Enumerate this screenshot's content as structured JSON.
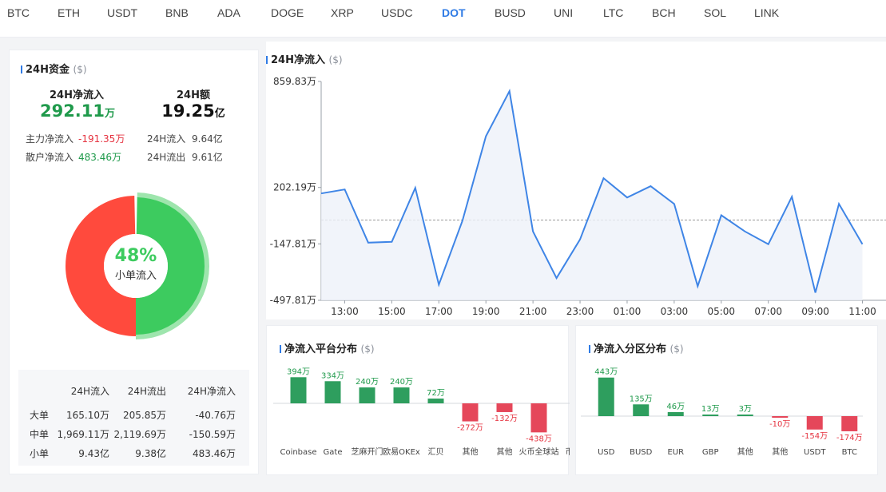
{
  "tabs": [
    "BTC",
    "ETH",
    "USDT",
    "BNB",
    "ADA",
    "DOGE",
    "XRP",
    "USDC",
    "DOT",
    "BUSD",
    "UNI",
    "LTC",
    "BCH",
    "SOL",
    "LINK"
  ],
  "active_tab": "DOT",
  "funds": {
    "title": "24H资金",
    "unit": "($)",
    "net_inflow_label": "24H净流入",
    "net_inflow_value": "292.11",
    "net_inflow_unit": "万",
    "volume_label": "24H额",
    "volume_value": "19.25",
    "volume_unit": "亿",
    "main_label": "主力净流入",
    "main_value": "-191.35万",
    "retail_label": "散户净流入",
    "retail_value": "483.46万",
    "in_label": "24H流入",
    "in_value": "9.64亿",
    "out_label": "24H流出",
    "out_value": "9.61亿",
    "donut_pct": "48%",
    "donut_label": "小单流入",
    "donut_fraction": 0.48,
    "colors": {
      "red": "#ff4a3d",
      "green": "#3dcb5f"
    }
  },
  "order_table": {
    "headers": [
      "24H流入",
      "24H流出",
      "24H净流入"
    ],
    "rows": [
      {
        "name": "大单",
        "in": "165.10万",
        "out": "205.85万",
        "net": "-40.76万",
        "sign": "neg"
      },
      {
        "name": "中单",
        "in": "1,969.11万",
        "out": "2,119.69万",
        "net": "-150.59万",
        "sign": "neg"
      },
      {
        "name": "小单",
        "in": "9.43亿",
        "out": "9.38亿",
        "net": "483.46万",
        "sign": "pos"
      }
    ]
  },
  "net_flow_chart": {
    "title": "24H净流入",
    "unit": "($)",
    "y_tick_labels": [
      "859.83万",
      "202.19万",
      "-147.81万",
      "-497.81万"
    ],
    "y_tick_values": [
      859.83,
      202.19,
      -147.81,
      -497.81
    ],
    "x_labels": [
      "13:00",
      "15:00",
      "17:00",
      "19:00",
      "21:00",
      "23:00",
      "01:00",
      "03:00",
      "05:00",
      "07:00",
      "09:00",
      "11:00"
    ],
    "chart_data": {
      "type": "area",
      "xlabel": "",
      "ylabel": "",
      "ylim": [
        -497.81,
        859.83
      ],
      "reference_line": 0,
      "x": [
        "12:00",
        "13:00",
        "14:00",
        "15:00",
        "16:00",
        "17:00",
        "18:00",
        "19:00",
        "20:00",
        "21:00",
        "22:00",
        "23:00",
        "00:00",
        "01:00",
        "02:00",
        "03:00",
        "04:00",
        "05:00",
        "06:00",
        "07:00",
        "08:00",
        "09:00",
        "10:00",
        "11:00",
        "12:00"
      ],
      "series": [
        {
          "values": [
            165,
            190,
            -140,
            -135,
            200,
            -400,
            -5,
            520,
            800,
            -70,
            -360,
            -120,
            260,
            140,
            210,
            100,
            -410,
            30,
            -70,
            -150,
            145,
            -450,
            100,
            -150,
            null
          ]
        }
      ]
    }
  },
  "platform_chart": {
    "title": "净流入平台分布",
    "unit": "($)",
    "chart_data": {
      "type": "bar",
      "categories": [
        "Coinbase",
        "Gate",
        "芝麻开门",
        "欧易OKEx",
        "汇贝",
        "其他",
        "其他",
        "火币全球站",
        "币安"
      ],
      "values": [
        394,
        334,
        240,
        240,
        72,
        -272,
        -132,
        -438,
        null
      ],
      "value_labels": [
        "394万",
        "334万",
        "240万",
        "240万",
        "72万",
        "-272万",
        "-132万",
        "-438万"
      ],
      "ylim": [
        -438,
        394
      ]
    }
  },
  "region_chart": {
    "title": "净流入分区分布",
    "unit": "($)",
    "chart_data": {
      "type": "bar",
      "categories": [
        "USD",
        "BUSD",
        "EUR",
        "GBP",
        "其他",
        "其他",
        "USDT",
        "BTC"
      ],
      "values": [
        443,
        135,
        46,
        13,
        3,
        -10,
        -154,
        -174
      ],
      "value_labels": [
        "443万",
        "135万",
        "46万",
        "13万",
        "3万",
        "-10万",
        "-154万",
        "-174万"
      ],
      "ylim": [
        -174,
        443
      ]
    }
  }
}
